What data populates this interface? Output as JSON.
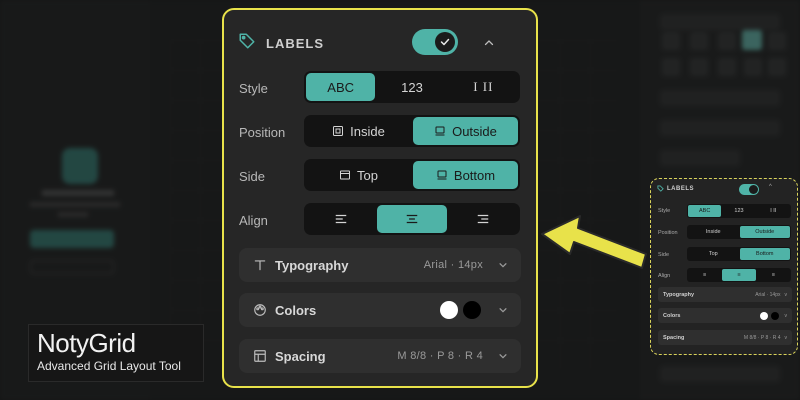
{
  "panel": {
    "title": "LABELS",
    "enabled": true,
    "style": {
      "label": "Style",
      "options": [
        "ABC",
        "123",
        "I II"
      ],
      "selected": "ABC"
    },
    "position": {
      "label": "Position",
      "options": [
        "Inside",
        "Outside"
      ],
      "selected": "Outside"
    },
    "side": {
      "label": "Side",
      "options": [
        "Top",
        "Bottom"
      ],
      "selected": "Bottom"
    },
    "align": {
      "label": "Align",
      "options": [
        "left",
        "center",
        "right"
      ],
      "selected": "center"
    },
    "sections": {
      "typography": {
        "name": "Typography",
        "meta": "Arial · 14px"
      },
      "colors": {
        "name": "Colors",
        "swatches": [
          "#ffffff",
          "#000000"
        ]
      },
      "spacing": {
        "name": "Spacing",
        "meta": "M 8/8 · P 8 · R 4"
      }
    }
  },
  "accent_color": "#4fb3a7",
  "highlight_color": "#e8e24a",
  "brand": {
    "name": "NotyGrid",
    "tagline": "Advanced Grid Layout Tool"
  }
}
